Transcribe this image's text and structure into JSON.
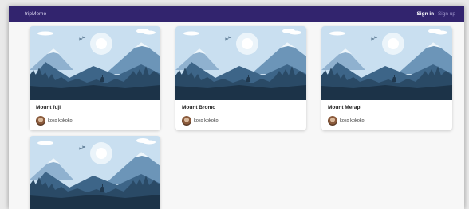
{
  "navbar": {
    "brand": "tripMemo",
    "signin_label": "Sign in",
    "signup_label": "Sign up"
  },
  "cards": [
    {
      "title": "Mount fuji",
      "author": "koko kokoko"
    },
    {
      "title": "Mount Bromo",
      "author": "koko kokoko"
    },
    {
      "title": "Mount Merapi",
      "author": "koko kokoko"
    },
    {
      "title": "",
      "author": ""
    }
  ],
  "colors": {
    "navbar": "#32246e",
    "sky": "#c7dff0",
    "mountain_dark": "#2e4f6c",
    "forest": "#1f3a52"
  }
}
